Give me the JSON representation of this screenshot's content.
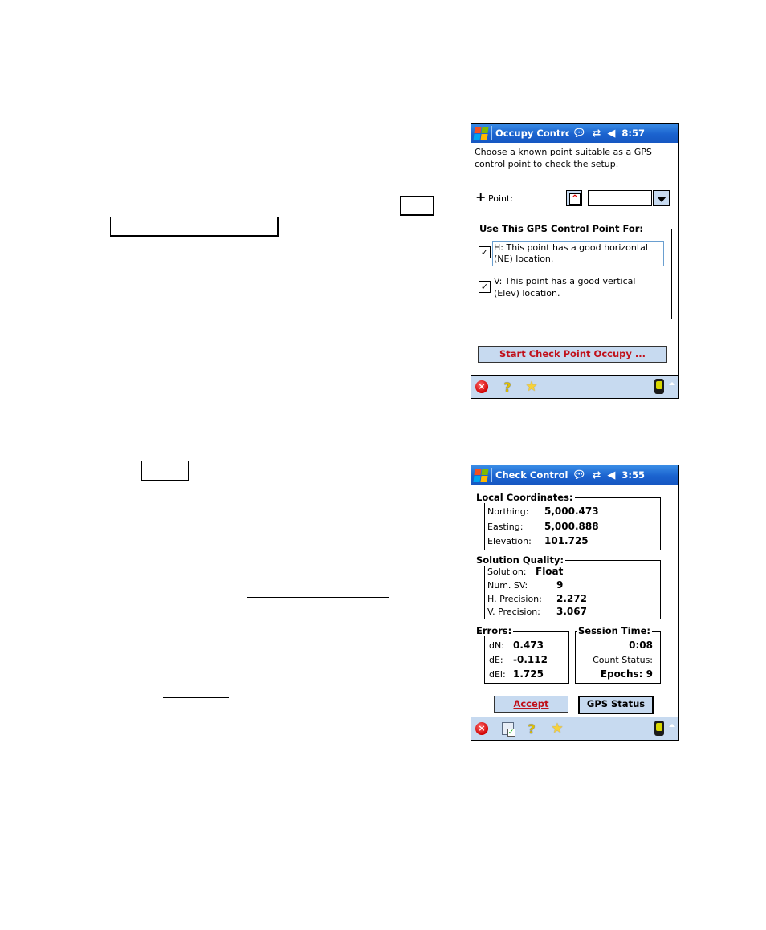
{
  "screen1": {
    "title": "Occupy Control",
    "time": "8:57",
    "status_icons": [
      "notification-bubble-icon",
      "connectivity-arrows-icon",
      "speaker-muted-icon"
    ],
    "instructions": [
      "Choose a known point suitable as a GPS",
      "control point to check the setup."
    ],
    "point_label": "Point:",
    "point_value": "",
    "group_title": "Use This GPS Control Point For:",
    "options": [
      {
        "checked": true,
        "line1": "H:  This point has a good horizontal",
        "line2": "(NE) location."
      },
      {
        "checked": true,
        "line1": "V:  This point has a good vertical",
        "line2": "(Elev) location."
      }
    ],
    "start_button": "Start Check Point Occupy ...",
    "taskbar_icons": [
      "close-icon",
      "help-icon",
      "favorites-star-icon",
      "gps-receiver-icon"
    ]
  },
  "screen2": {
    "title": "Check Control F",
    "time": "3:55",
    "local_coords": {
      "title": "Local Coordinates:",
      "rows": [
        {
          "label": "Northing:",
          "value": "5,000.473"
        },
        {
          "label": "Easting:",
          "value": "5,000.888"
        },
        {
          "label": "Elevation:",
          "value": "101.725"
        }
      ]
    },
    "solution_quality": {
      "title": "Solution Quality:",
      "rows": [
        {
          "label": "Solution:",
          "value": "Float"
        },
        {
          "label": "Num. SV:",
          "value": "9"
        },
        {
          "label": "H. Precision:",
          "value": "2.272"
        },
        {
          "label": "V. Precision:",
          "value": "3.067"
        }
      ]
    },
    "errors": {
      "title": "Errors:",
      "rows": [
        {
          "label": "dN:",
          "value": "0.473"
        },
        {
          "label": "dE:",
          "value": "-0.112"
        },
        {
          "label": "dEl:",
          "value": "1.725"
        }
      ]
    },
    "session": {
      "title": "Session Time:",
      "time": "0:08",
      "count_label": "Count Status:",
      "epochs": "Epochs: 9"
    },
    "accept_button": "Accept",
    "gps_status_button": "GPS Status",
    "taskbar_icons": [
      "close-icon",
      "properties-icon",
      "help-icon",
      "favorites-star-icon",
      "gps-receiver-icon"
    ]
  }
}
